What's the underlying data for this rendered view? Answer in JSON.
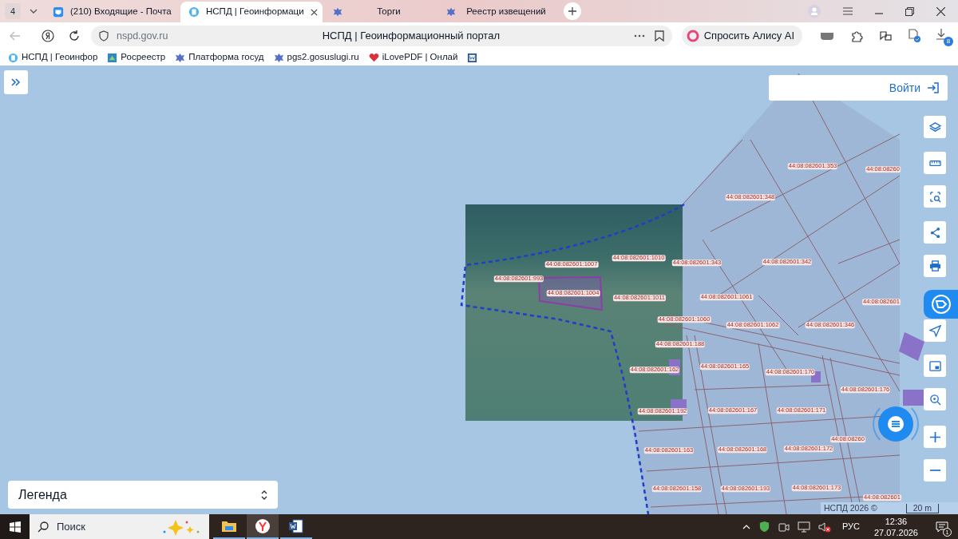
{
  "browser": {
    "tab_count": "4",
    "tabs": [
      {
        "title": "(210) Входящие - Почта",
        "selected": false
      },
      {
        "title": "НСПД | Геоинформаци",
        "selected": true
      },
      {
        "title": "Торги",
        "selected": false
      },
      {
        "title": "Реестр извещений",
        "selected": false
      }
    ],
    "address": "nspd.gov.ru",
    "page_title": "НСПД | Геоинформационный портал",
    "alice_button": "Спросить Алису AI",
    "downloads_badge": "8",
    "bookmarks": [
      "НСПД | Геоинфор",
      "Росреестр",
      "Платформа госуд",
      "pgs2.gosuslugi.ru",
      "iLovePDF | Онлай"
    ]
  },
  "map": {
    "login_button": "Войти",
    "parcels": [
      "44:08:082601:353",
      "44:08:08260",
      "44:08:082601:348",
      "44:08:082601:1007",
      "44:08:082601:1010",
      "44:08:082601:343",
      "44:08:082601:342",
      "44:08:082601:993",
      "44:08:082601:1004",
      "44:08:082601:1011",
      "44:08:082601:1061",
      "44:08:082601",
      "44:08:082601:1060",
      "44:08:082601:1062",
      "44:08:082601:346",
      "44:08:082601:188",
      "44:08:082601:162",
      "44:08:082601:165",
      "44:08:082601:170",
      "44:08:082601:176",
      "44:08:082601:192",
      "44:08:082601:167",
      "44:08:082601:171",
      "44:08:08260",
      "44:08:082601:163",
      "44:08:082601:168",
      "44:08:082601:172",
      "44:08:082601:158",
      "44:08:082601:193",
      "44:08:082601:173",
      "44:08:082601"
    ],
    "legend": "Легенда",
    "attribution": "НСПД 2026 ©",
    "scale": "20 m"
  },
  "taskbar": {
    "search_placeholder": "Поиск",
    "language": "РУС",
    "time": "12:36",
    "date": "27.07.2026",
    "notifications": "1"
  }
}
